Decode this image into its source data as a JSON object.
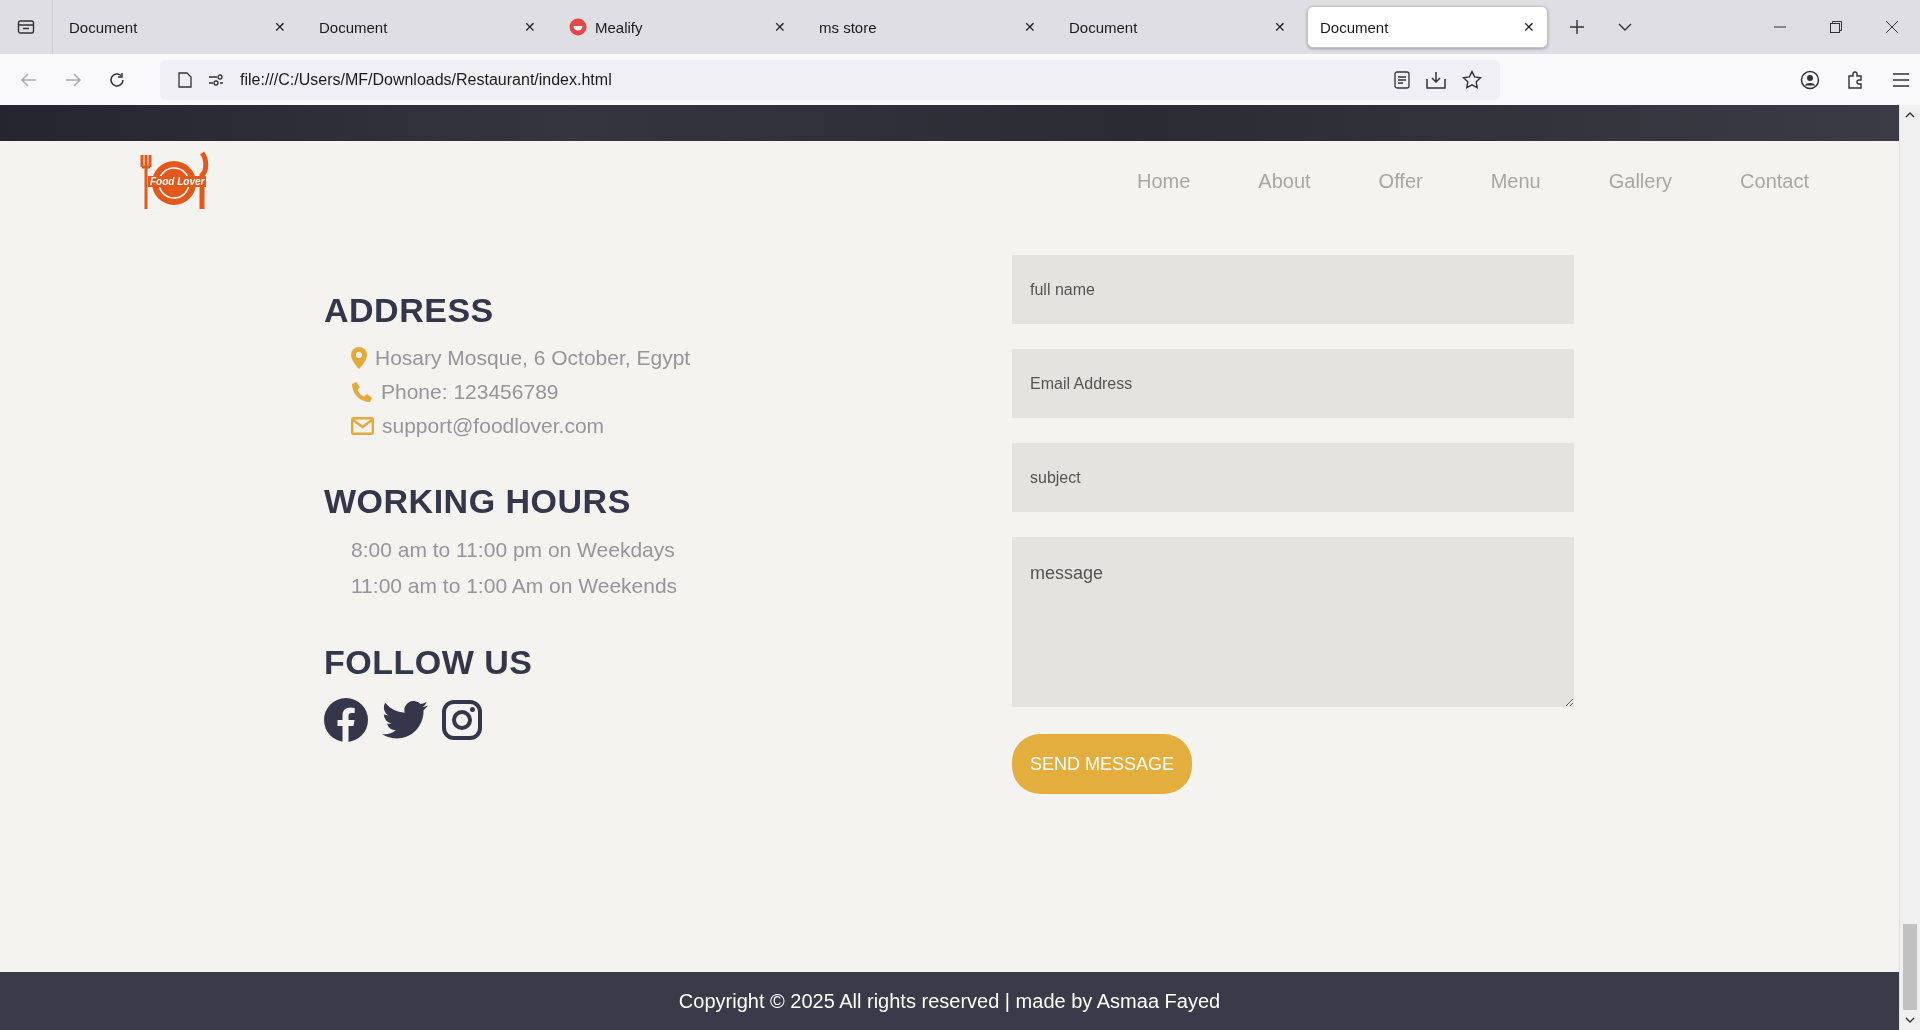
{
  "browser": {
    "tabs": [
      {
        "title": "Document",
        "selected": false,
        "kind": "plain"
      },
      {
        "title": "Document",
        "selected": false,
        "kind": "plain"
      },
      {
        "title": "Mealify",
        "selected": false,
        "kind": "favicon"
      },
      {
        "title": "ms store",
        "selected": false,
        "kind": "plain"
      },
      {
        "title": "Document",
        "selected": false,
        "kind": "plain"
      },
      {
        "title": "Document",
        "selected": true,
        "kind": "plain"
      }
    ],
    "close_glyph": "✕",
    "url": "file:///C:/Users/MF/Downloads/Restaurant/index.html"
  },
  "header": {
    "logo_text": "Food Lover",
    "nav": [
      {
        "label": "Home"
      },
      {
        "label": "About"
      },
      {
        "label": "Offer"
      },
      {
        "label": "Menu"
      },
      {
        "label": "Gallery"
      },
      {
        "label": "Contact"
      }
    ]
  },
  "address": {
    "heading": "ADDRESS",
    "items": [
      {
        "kind": "pin",
        "text": "Hosary Mosque, 6 October, Egypt"
      },
      {
        "kind": "phone",
        "text": "Phone: 123456789"
      },
      {
        "kind": "mail",
        "text": "support@foodlover.com"
      }
    ]
  },
  "working_hours": {
    "heading": "WORKING HOURS",
    "lines": [
      "8:00 am to 11:00 pm on Weekdays",
      "11:00 am to 1:00 Am on Weekends"
    ]
  },
  "follow_us": {
    "heading": "FOLLOW US",
    "links": [
      {
        "kind": "facebook"
      },
      {
        "kind": "twitter"
      },
      {
        "kind": "instagram"
      }
    ]
  },
  "form": {
    "fields": [
      {
        "kind": "input",
        "placeholder": "full name"
      },
      {
        "kind": "input",
        "placeholder": "Email Address"
      },
      {
        "kind": "input",
        "placeholder": "subject"
      },
      {
        "kind": "textarea",
        "placeholder": "message"
      }
    ],
    "submit": "SEND MESSAGE"
  },
  "footer": {
    "text": "Copyright © 2025 All rights reserved | made by Asmaa Fayed"
  }
}
